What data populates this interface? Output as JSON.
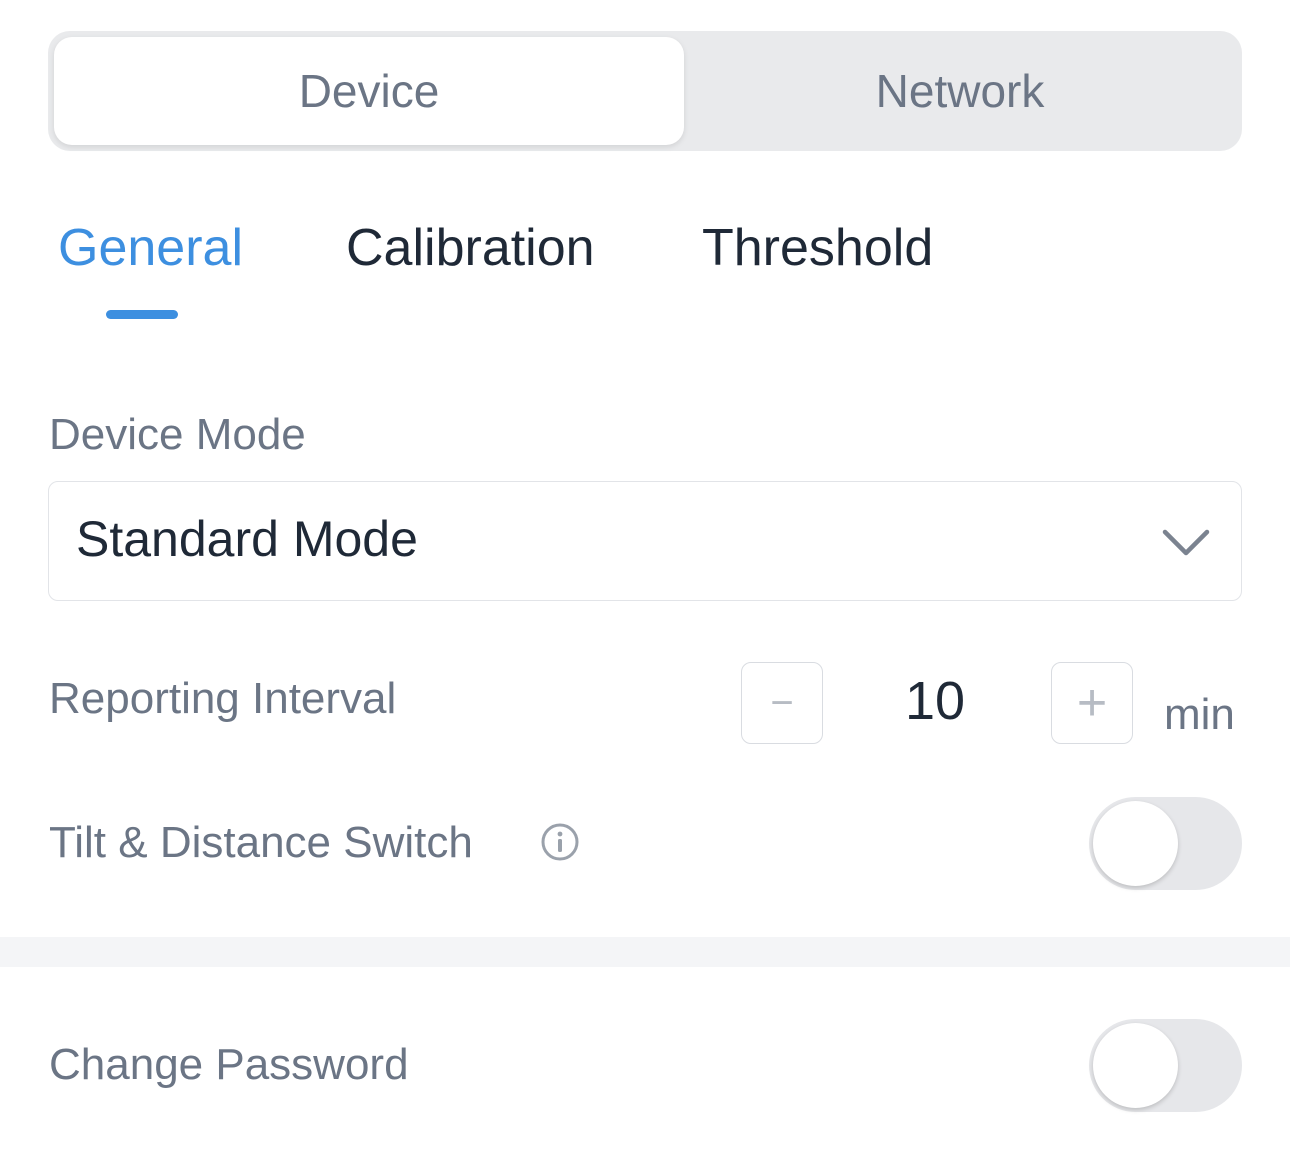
{
  "segmented": {
    "items": [
      {
        "label": "Device",
        "selected": true
      },
      {
        "label": "Network",
        "selected": false
      }
    ]
  },
  "tabs": {
    "items": [
      {
        "label": "General",
        "active": true
      },
      {
        "label": "Calibration",
        "active": false
      },
      {
        "label": "Threshold",
        "active": false
      }
    ]
  },
  "form": {
    "device_mode": {
      "label": "Device Mode",
      "value": "Standard Mode"
    },
    "reporting_interval": {
      "label": "Reporting Interval",
      "decrement_symbol": "−",
      "increment_symbol": "+",
      "value": "10",
      "unit": "min"
    },
    "tilt_distance_switch": {
      "label": "Tilt & Distance Switch",
      "on": false
    },
    "change_password": {
      "label": "Change Password",
      "on": false
    }
  },
  "colors": {
    "accent": "#3d8fe0",
    "label": "#6b7585",
    "text": "#1f2937",
    "toggle_off": "#e6e7ea"
  },
  "icons": {
    "select": "chevron-down-icon",
    "info": "info-icon"
  }
}
